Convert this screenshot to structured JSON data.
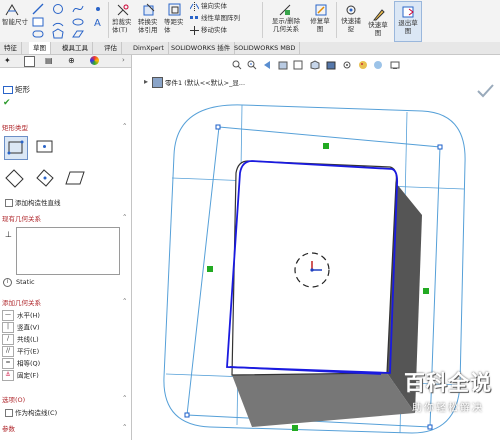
{
  "ribbon": {
    "smart_dim_label": "智能尺寸",
    "cut_entity_label": "剪裁实体(T)",
    "convert_entity_label": "转换实体引用",
    "offset_entity_label": "等距实体",
    "mirror_entity_label": "镜向实体",
    "linear_pattern_label": "线性草图阵列",
    "move_entity_label": "移动实体",
    "display_delete_relations_label": "显示/删除几何关系",
    "repair_sketch_label": "修复草图",
    "quick_snaps_label": "快速捕捉",
    "rapid_sketch_label": "快速草图",
    "exit_sketch_label": "退出草图"
  },
  "tabs": [
    "特征",
    "草图",
    "模具工具",
    "评估",
    "DimXpert",
    "SOLIDWORKS 插件",
    "SOLIDWORKS MBD"
  ],
  "active_tab": "草图",
  "panel": {
    "title": "矩形",
    "sec_rect_type": "矩形类型",
    "add_construction_label": "添加构造性直线",
    "sec_existing_relations": "现有几何关系",
    "status_label": "Static",
    "sec_add_relations": "添加几何关系",
    "relations": [
      "水平(H)",
      "竖直(V)",
      "共线(L)",
      "平行(E)",
      "相等(Q)",
      "固定(F)"
    ],
    "sec_options": "选项(O)",
    "for_construction_label": "作为构造线(C)",
    "sec_params": "参数"
  },
  "canvas": {
    "tree_breadcrumb": "零件1 (默认<<默认>_显..."
  },
  "watermark": {
    "title": "百科全说",
    "subtitle": "助你轻松解决"
  },
  "colors": {
    "sketch_blue": "#1a1adf",
    "construction_blue": "#56a0d8",
    "relation_green": "#22aa22",
    "panel_section_red": "#b0282d"
  }
}
